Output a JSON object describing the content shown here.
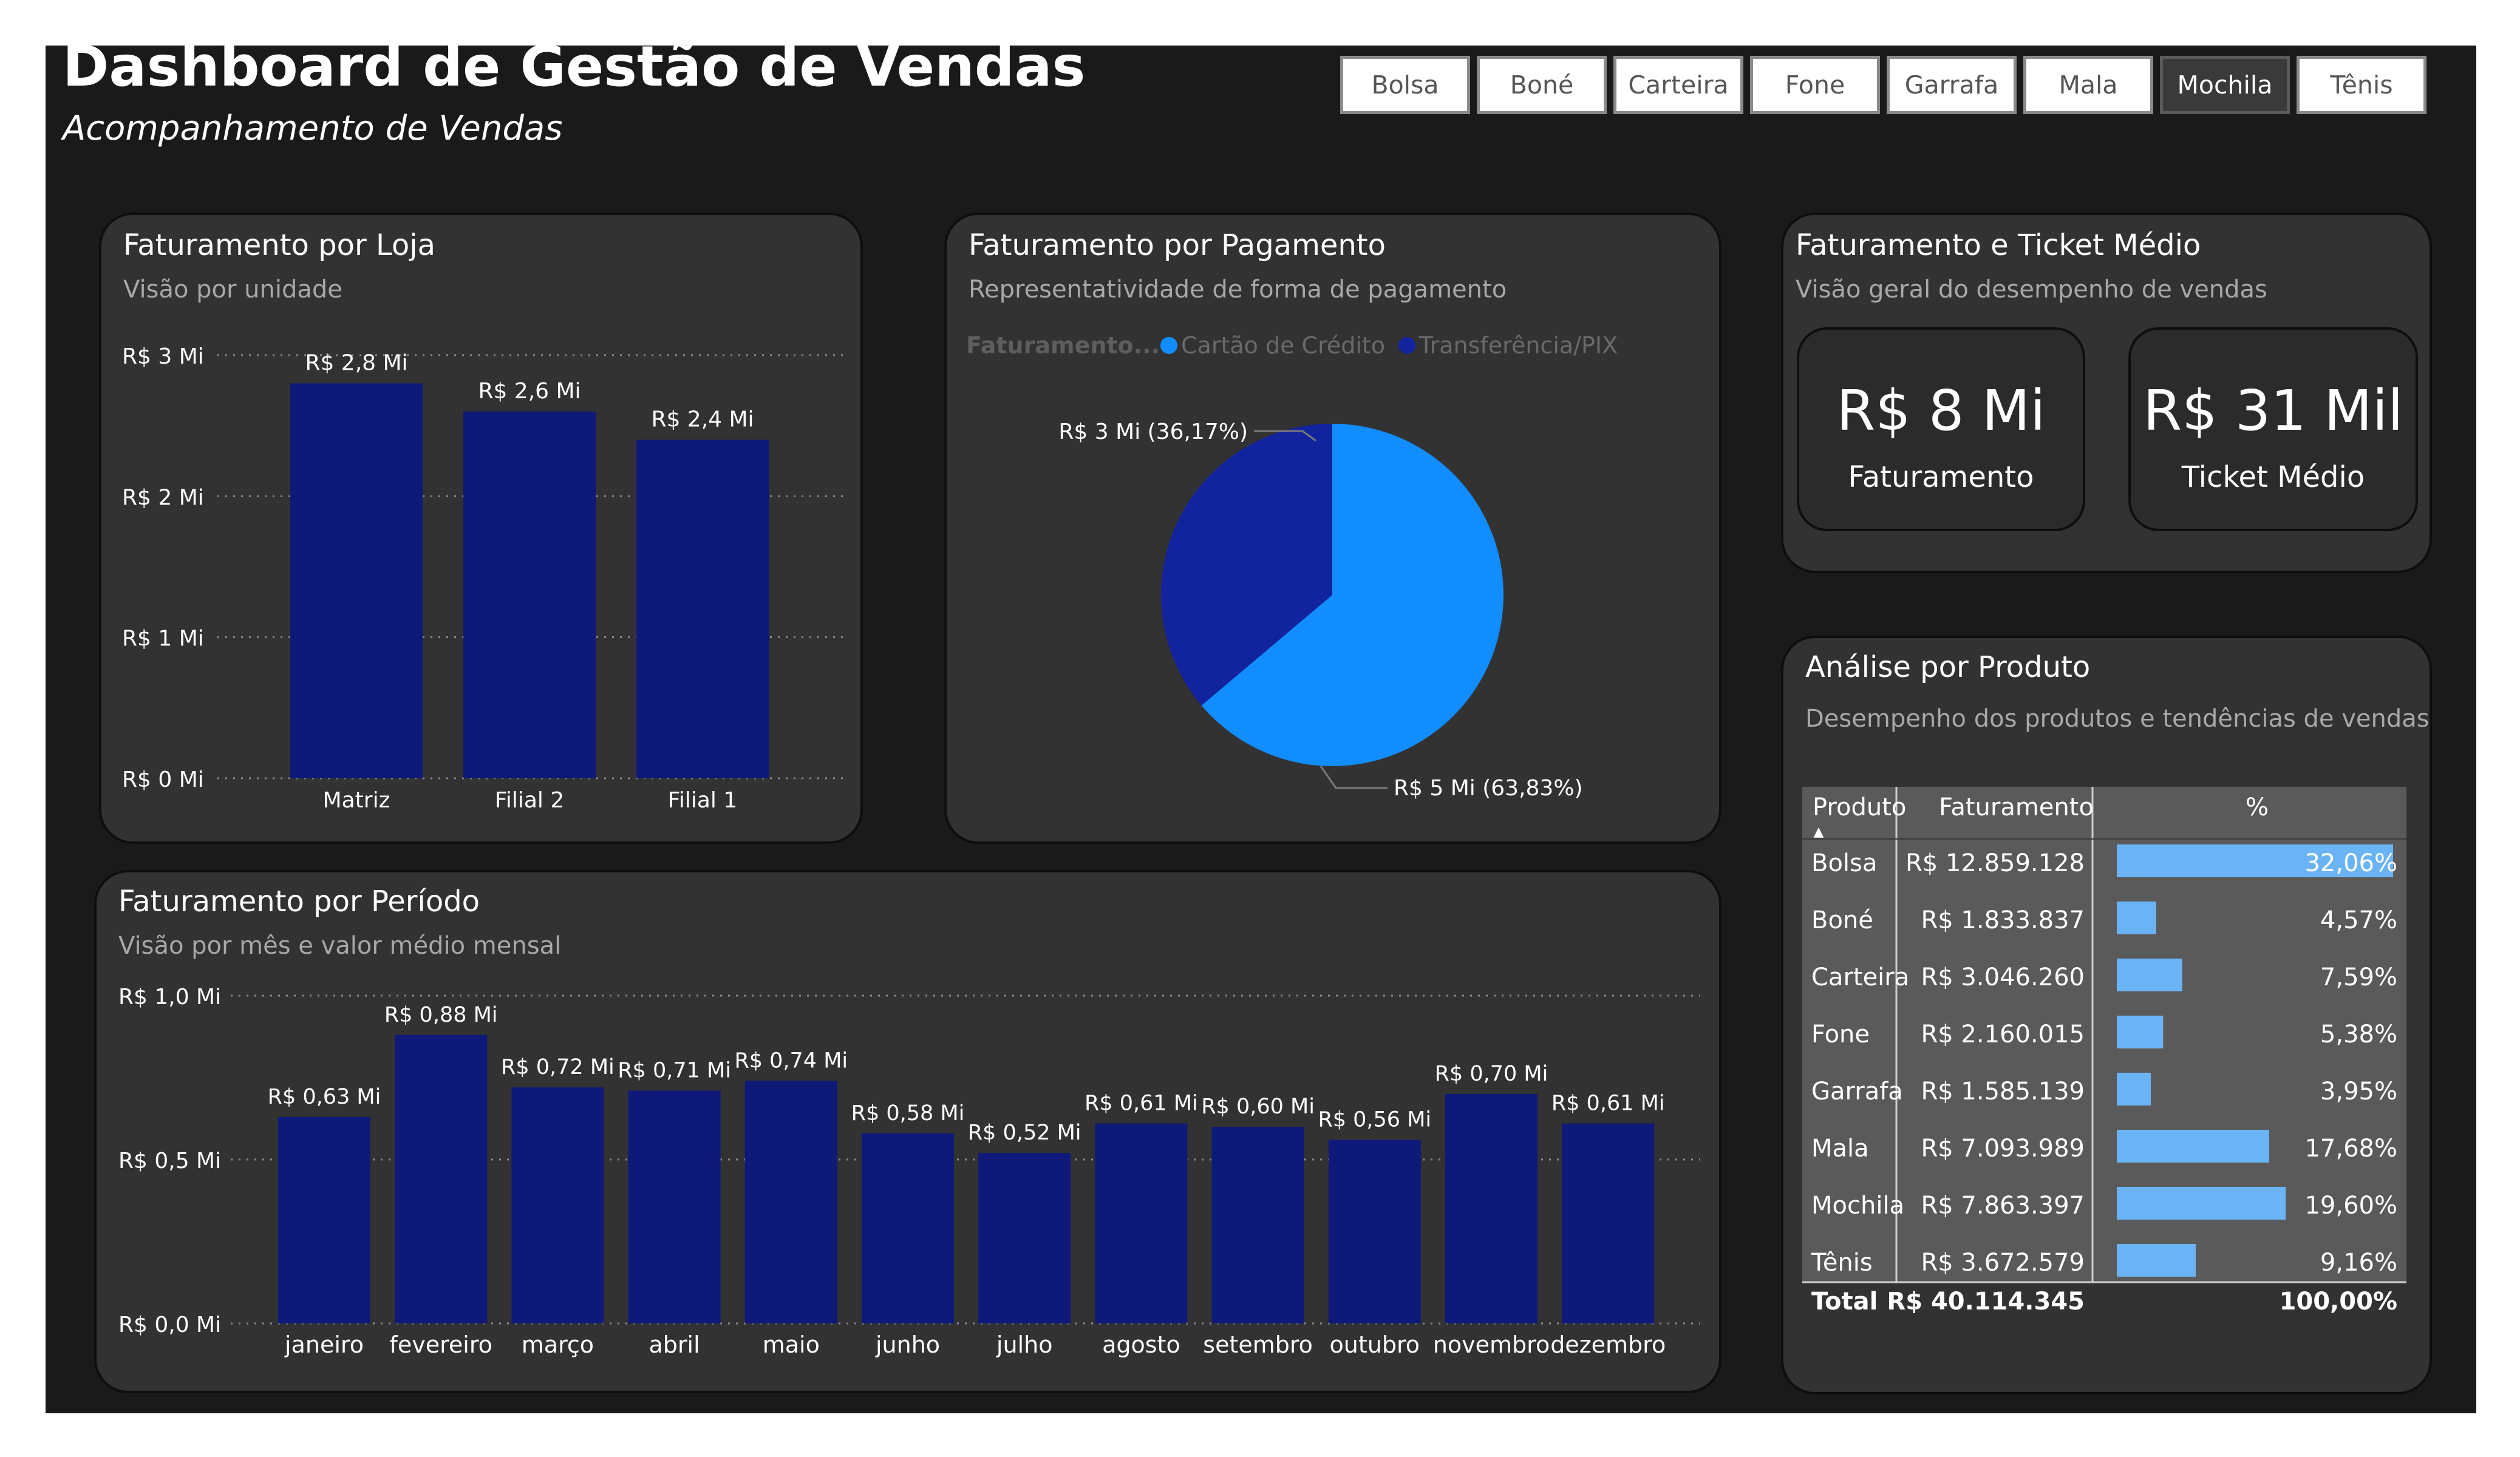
{
  "header": {
    "title": "Dashboard de Gestão de Vendas",
    "subtitle": "Acompanhamento de Vendas"
  },
  "slicer": {
    "items": [
      "Bolsa",
      "Boné",
      "Carteira",
      "Fone",
      "Garrafa",
      "Mala",
      "Mochila",
      "Tênis"
    ],
    "selected": "Mochila"
  },
  "colors": {
    "bar": "#0e197a",
    "pie_credit": "#118dff",
    "pie_pix": "#12239e",
    "table_bar": "#6ab4f5",
    "card_bg": "#323232"
  },
  "store_card": {
    "title": "Faturamento por Loja",
    "subtitle": "Visão por unidade"
  },
  "payment_card": {
    "title": "Faturamento por Pagamento",
    "subtitle": "Representatividade de forma de pagamento"
  },
  "kpi_card": {
    "title": "Faturamento e Ticket Médio",
    "subtitle": "Visão geral do desempenho de vendas",
    "faturamento_value": "R$ 8 Mi",
    "faturamento_label": "Faturamento",
    "ticket_value": "R$ 31 Mil",
    "ticket_label": "Ticket Médio"
  },
  "period_card": {
    "title": "Faturamento por Período",
    "subtitle": "Visão por mês e valor médio mensal"
  },
  "product_card": {
    "title": "Análise por Produto",
    "subtitle": "Desempenho dos produtos e tendências de vendas"
  },
  "chart_data": [
    {
      "type": "bar",
      "categories": [
        "Matriz",
        "Filial 2",
        "Filial 1"
      ],
      "values": [
        2.8,
        2.6,
        2.4
      ],
      "data_labels": [
        "R$ 2,8 Mi",
        "R$ 2,6 Mi",
        "R$ 2,4 Mi"
      ],
      "yticks": [
        0,
        1,
        2,
        3
      ],
      "ytick_labels": [
        "R$ 0 Mi",
        "R$ 1 Mi",
        "R$ 2 Mi",
        "R$ 3 Mi"
      ],
      "ylim": [
        0,
        3
      ],
      "grid": true
    },
    {
      "type": "pie",
      "legend_title": "Faturamento...",
      "legend_position": "top-left",
      "slices": [
        {
          "name": "Cartão de Crédito",
          "value": 63.83,
          "label": "R$ 5 Mi (63,83%)"
        },
        {
          "name": "Transferência/PIX",
          "value": 36.17,
          "label": "R$ 3 Mi (36,17%)"
        }
      ]
    },
    {
      "type": "bar",
      "categories": [
        "janeiro",
        "fevereiro",
        "março",
        "abril",
        "maio",
        "junho",
        "julho",
        "agosto",
        "setembro",
        "outubro",
        "novembro",
        "dezembro"
      ],
      "values": [
        0.63,
        0.88,
        0.72,
        0.71,
        0.74,
        0.58,
        0.52,
        0.61,
        0.6,
        0.56,
        0.7,
        0.61
      ],
      "data_labels": [
        "R$ 0,63 Mi",
        "R$ 0,88 Mi",
        "R$ 0,72 Mi",
        "R$ 0,71 Mi",
        "R$ 0,74 Mi",
        "R$ 0,58 Mi",
        "R$ 0,52 Mi",
        "R$ 0,61 Mi",
        "R$ 0,60 Mi",
        "R$ 0,56 Mi",
        "R$ 0,70 Mi",
        "R$ 0,61 Mi"
      ],
      "yticks": [
        0,
        0.5,
        1.0
      ],
      "ytick_labels": [
        "R$ 0,0 Mi",
        "R$ 0,5 Mi",
        "R$ 1,0 Mi"
      ],
      "ylim": [
        0,
        1.0
      ],
      "grid": true
    },
    {
      "type": "table",
      "columns": [
        "Produto",
        "Faturamento",
        "%"
      ],
      "sort_indicator": "▲",
      "rows": [
        {
          "produto": "Bolsa",
          "faturamento": "R$ 12.859.128",
          "pct": 32.06,
          "pct_label": "32,06%"
        },
        {
          "produto": "Boné",
          "faturamento": "R$ 1.833.837",
          "pct": 4.57,
          "pct_label": "4,57%"
        },
        {
          "produto": "Carteira",
          "faturamento": "R$ 3.046.260",
          "pct": 7.59,
          "pct_label": "7,59%"
        },
        {
          "produto": "Fone",
          "faturamento": "R$ 2.160.015",
          "pct": 5.38,
          "pct_label": "5,38%"
        },
        {
          "produto": "Garrafa",
          "faturamento": "R$ 1.585.139",
          "pct": 3.95,
          "pct_label": "3,95%"
        },
        {
          "produto": "Mala",
          "faturamento": "R$ 7.093.989",
          "pct": 17.68,
          "pct_label": "17,68%"
        },
        {
          "produto": "Mochila",
          "faturamento": "R$ 7.863.397",
          "pct": 19.6,
          "pct_label": "19,60%"
        },
        {
          "produto": "Tênis",
          "faturamento": "R$ 3.672.579",
          "pct": 9.16,
          "pct_label": "9,16%"
        }
      ],
      "total": {
        "label": "Total",
        "faturamento": "R$ 40.114.345",
        "pct_label": "100,00%"
      }
    }
  ]
}
